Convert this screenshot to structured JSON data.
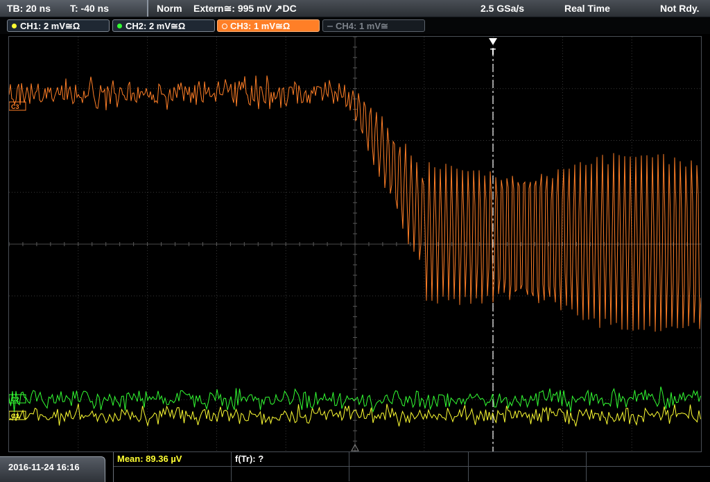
{
  "status": {
    "timebase": "TB: 20 ns",
    "trigger_time": "T: -40 ns",
    "trigger_mode": "Norm",
    "trigger_source": "Extern≅: 995 mV ↗DC",
    "sample_rate": "2.5 GSa/s",
    "acq_mode": "Real Time",
    "trigger_state": "Not Rdy."
  },
  "channels": [
    {
      "label": "CH1: 2 mV≅Ω",
      "color": "#ffff33",
      "active": true
    },
    {
      "label": "CH2: 2 mV≅Ω",
      "color": "#33ff33",
      "active": true
    },
    {
      "label": "CH3: 1 mV≅Ω",
      "color": "#ff7f27",
      "active": true
    },
    {
      "label": "CH4: 1 mV≅",
      "color": "#9aa0a8",
      "active": false
    }
  ],
  "markers": {
    "ch3": "C3",
    "ch2": "C2",
    "ch1": "C1",
    "trigger": "T"
  },
  "footer": {
    "datetime": "2016-11-24 16:16",
    "mean_label": "Mean: 89.36 µV",
    "ftr_label": "f(Tr): ?"
  },
  "colors": {
    "ch1": "#ffff33",
    "ch2": "#33ff33",
    "ch3": "#ff7f27",
    "grid": "#3a3a3a",
    "trigger_line": "#ffffff"
  }
}
